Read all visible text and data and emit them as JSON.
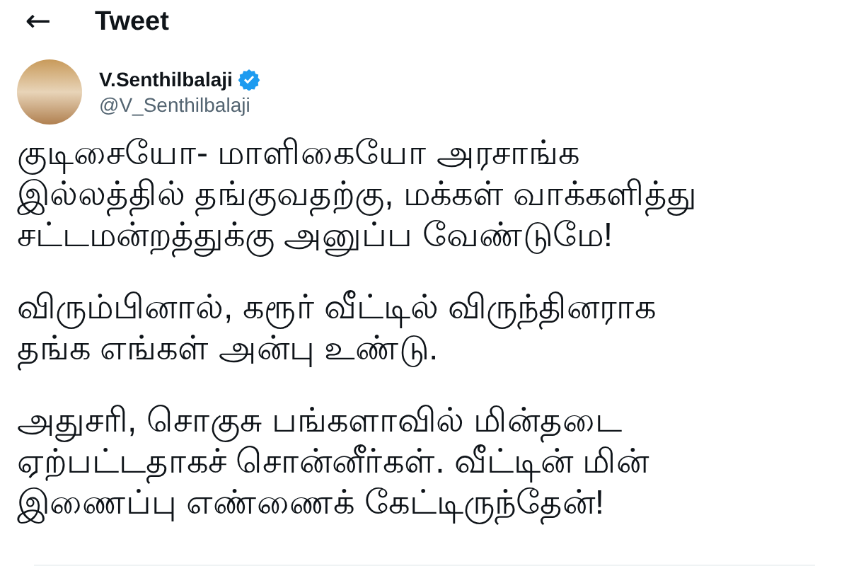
{
  "header": {
    "back": "←",
    "title": "Tweet"
  },
  "author": {
    "name": "V.Senthilbalaji",
    "verified": true,
    "handle": "@V_Senthilbalaji"
  },
  "paragraphs": [
    "குடிசையோ- மாளிகையோ அரசாங்க\nஇல்லத்தில் தங்குவதற்கு, மக்கள் வாக்களித்து\nசட்டமன்றத்துக்கு அனுப்ப வேண்டுமே!",
    "விரும்பினால், கரூர் வீட்டில் விருந்தினராக\nதங்க எங்கள் அன்பு உண்டு.",
    "அதுசரி, சொகுசு பங்களாவில் மின்தடை\nஏற்பட்டதாகச் சொன்னீர்கள். வீட்டின் மின்\nஇணைப்பு எண்ணைக் கேட்டிருந்தேன்!"
  ]
}
